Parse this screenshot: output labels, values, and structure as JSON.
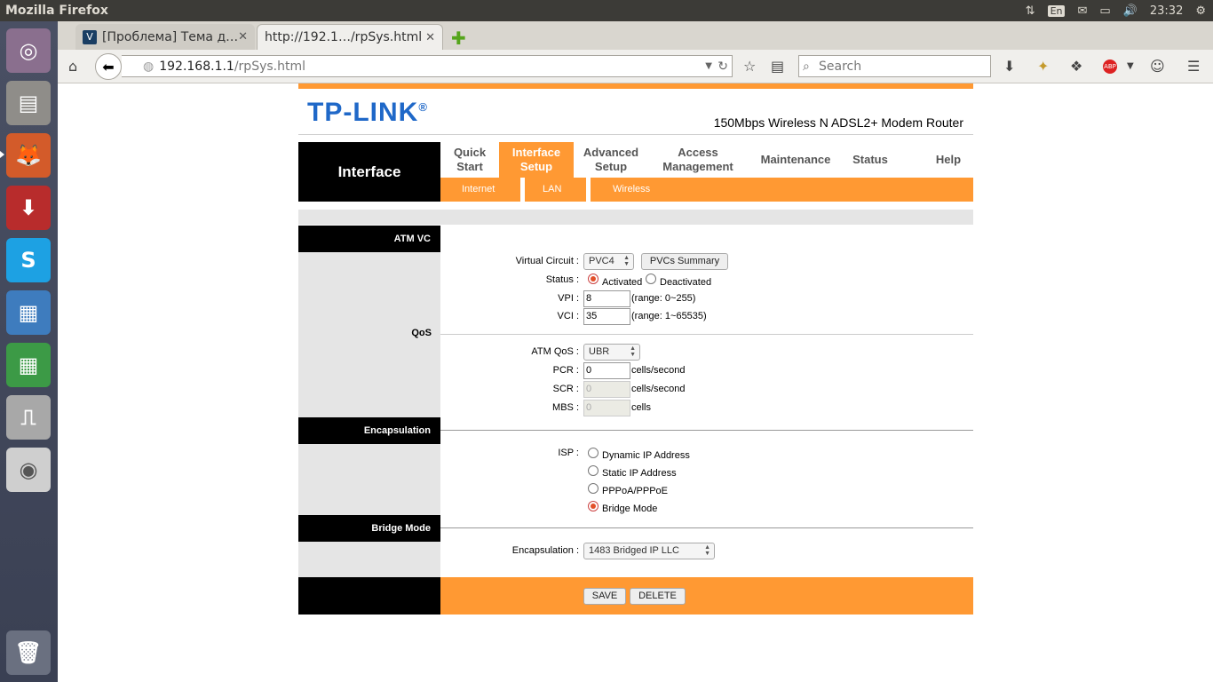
{
  "system": {
    "app_title": "Mozilla Firefox",
    "keyboard_layout": "En",
    "clock": "23:32"
  },
  "browser": {
    "tabs": [
      {
        "label": "[Проблема] Тема д…",
        "active": false
      },
      {
        "label": "http://192.1…/rpSys.html",
        "active": true
      }
    ],
    "url_host": "192.168.1.1",
    "url_path": "/rpSys.html",
    "search_placeholder": "Search"
  },
  "router": {
    "logo": "TP-LINK",
    "logo_mark": "®",
    "model": "150Mbps Wireless N ADSL2+ Modem Router",
    "page_title": "Interface",
    "menu": [
      {
        "line1": "Quick",
        "line2": "Start"
      },
      {
        "line1": "Interface",
        "line2": "Setup"
      },
      {
        "line1": "Advanced",
        "line2": "Setup"
      },
      {
        "line1": "Access",
        "line2": "Management"
      },
      {
        "line1": "Maintenance",
        "line2": ""
      },
      {
        "line1": "Status",
        "line2": ""
      },
      {
        "line1": "Help",
        "line2": ""
      }
    ],
    "submenu": [
      "Internet",
      "LAN",
      "Wireless"
    ],
    "sections": {
      "atm_vc": "ATM VC",
      "qos": "QoS",
      "encapsulation": "Encapsulation",
      "bridge_mode": "Bridge Mode"
    },
    "fields": {
      "virtual_circuit_label": "Virtual Circuit :",
      "virtual_circuit_value": "PVC4",
      "pvcs_summary": "PVCs Summary",
      "status_label": "Status :",
      "status_activated": "Activated",
      "status_deactivated": "Deactivated",
      "vpi_label": "VPI :",
      "vpi_value": "8",
      "vpi_range": "(range: 0~255)",
      "vci_label": "VCI :",
      "vci_value": "35",
      "vci_range": "(range: 1~65535)",
      "atm_qos_label": "ATM QoS :",
      "atm_qos_value": "UBR",
      "pcr_label": "PCR :",
      "pcr_value": "0",
      "pcr_unit": "cells/second",
      "scr_label": "SCR :",
      "scr_value": "0",
      "scr_unit": "cells/second",
      "mbs_label": "MBS :",
      "mbs_value": "0",
      "mbs_unit": "cells",
      "isp_label": "ISP :",
      "isp_options": [
        "Dynamic IP Address",
        "Static IP Address",
        "PPPoA/PPPoE",
        "Bridge Mode"
      ],
      "encap_label": "Encapsulation :",
      "encap_value": "1483 Bridged IP LLC"
    },
    "buttons": {
      "save": "SAVE",
      "delete": "DELETE"
    }
  },
  "colors": {
    "accent": "#ff9933",
    "logo_blue": "#1f68c8"
  }
}
